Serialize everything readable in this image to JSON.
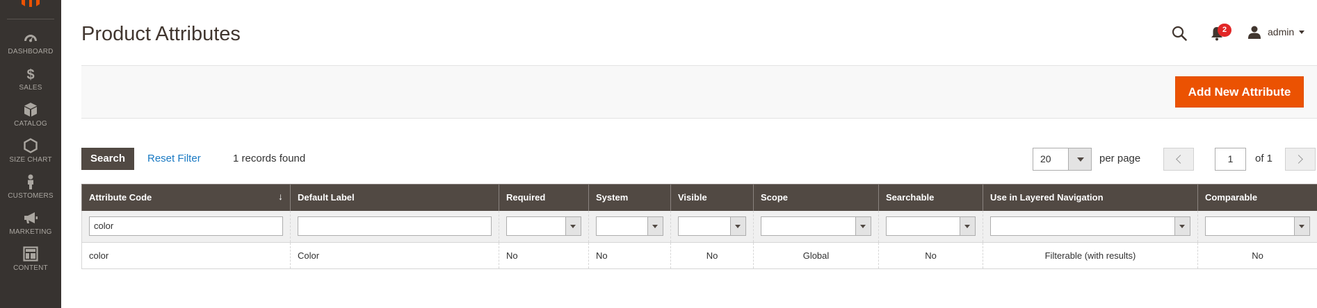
{
  "sidebar": {
    "items": [
      {
        "label": "DASHBOARD",
        "icon": "dashboard-icon"
      },
      {
        "label": "SALES",
        "icon": "dollar-icon"
      },
      {
        "label": "CATALOG",
        "icon": "cube-icon"
      },
      {
        "label": "SIZE CHART",
        "icon": "hexagon-icon"
      },
      {
        "label": "CUSTOMERS",
        "icon": "person-icon"
      },
      {
        "label": "MARKETING",
        "icon": "megaphone-icon"
      },
      {
        "label": "CONTENT",
        "icon": "layout-icon"
      }
    ]
  },
  "header": {
    "title": "Product Attributes",
    "notifications_count": "2",
    "user": "admin"
  },
  "actions": {
    "add_label": "Add New Attribute"
  },
  "grid_controls": {
    "search_label": "Search",
    "reset_label": "Reset Filter",
    "records_text": "1 records found",
    "per_page_value": "20",
    "per_page_label": "per page",
    "page_value": "1",
    "page_of": "of 1"
  },
  "table": {
    "columns": [
      "Attribute Code",
      "Default Label",
      "Required",
      "System",
      "Visible",
      "Scope",
      "Searchable",
      "Use in Layered Navigation",
      "Comparable"
    ],
    "sort_indicator": "↓",
    "filter_attribute_code": "color",
    "rows": [
      [
        "color",
        "Color",
        "No",
        "No",
        "No",
        "Global",
        "No",
        "Filterable (with results)",
        "No"
      ]
    ]
  },
  "colors": {
    "accent": "#eb5202",
    "sidebar_bg": "#373330",
    "header_bg": "#514943",
    "link": "#1979c3",
    "badge": "#e22626"
  }
}
